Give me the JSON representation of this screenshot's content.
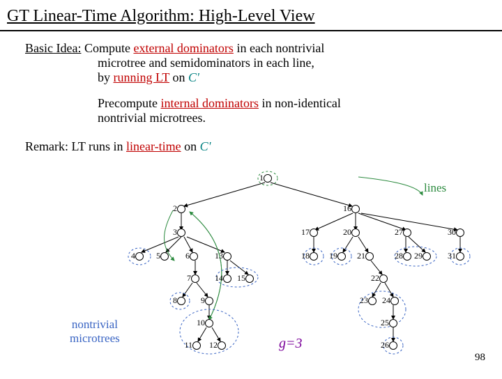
{
  "title": "GT Linear-Time Algorithm: High-Level View",
  "p1": {
    "lead": "Basic Idea:",
    "line1a": " Compute  ",
    "ext": "external dominators",
    "line1b": "  in each nontrivial ",
    "line2": "microtree and semidominators in each line, ",
    "line3a": "by ",
    "run": "running LT",
    "line3b": " on  ",
    "cprime": "C'"
  },
  "p2": {
    "line1a": "Precompute ",
    "int": "internal dominators",
    "line1b": " in non-identical ",
    "line2": "nontrivial microtrees."
  },
  "remark": {
    "a": "Remark: LT runs in ",
    "lt": "linear-time",
    "b": " on  ",
    "cprime": "C'"
  },
  "labels": {
    "lines": "lines",
    "nontrivial": "nontrivial",
    "microtrees": "microtrees",
    "g3": "g=3"
  },
  "pagenum": "98",
  "nodes": {
    "n1": "1",
    "n2": "2",
    "n3": "3",
    "n4": "4",
    "n5": "5",
    "n6": "6",
    "n7": "7",
    "n8": "8",
    "n9": "9",
    "n10": "10",
    "n11": "11",
    "n12": "12",
    "n13": "13",
    "n14": "14",
    "n15": "15",
    "n16": "16",
    "n17": "17",
    "n18": "18",
    "n19": "19",
    "n20": "20",
    "n21": "21",
    "n22": "22",
    "n23": "23",
    "n24": "24",
    "n25": "25",
    "n26": "26",
    "n27": "27",
    "n28": "28",
    "n29": "29",
    "n30": "30",
    "n31": "31"
  }
}
